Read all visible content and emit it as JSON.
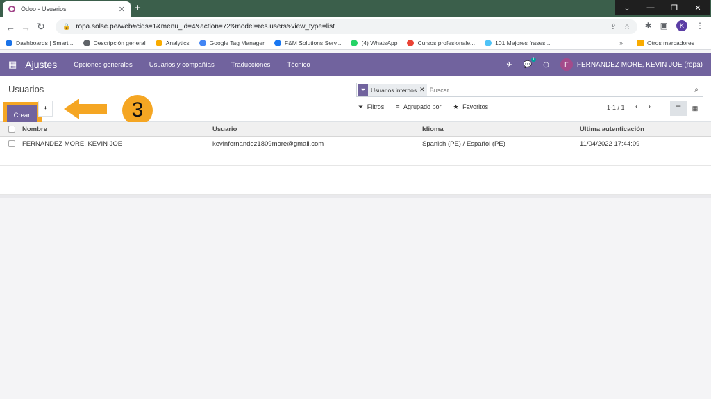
{
  "browser": {
    "tab_title": "Odoo - Usuarios",
    "tab_close": "✕",
    "new_tab": "+",
    "url": "ropa.solse.pe/web#cids=1&menu_id=4&action=72&model=res.users&view_type=list",
    "profile_initial": "K",
    "bookmarks": [
      {
        "label": "Dashboards | Smart...",
        "color": "#1a73e8"
      },
      {
        "label": "Descripción general",
        "color": "#5f6368"
      },
      {
        "label": "Analytics",
        "color": "#f9ab00"
      },
      {
        "label": "Google Tag Manager",
        "color": "#4285f4"
      },
      {
        "label": "F&M Solutions Serv...",
        "color": "#1877f2"
      },
      {
        "label": "(4) WhatsApp",
        "color": "#25d366"
      },
      {
        "label": "Cursos profesionale...",
        "color": "#ea4335"
      },
      {
        "label": "101 Mejores frases...",
        "color": "#4fc3f7"
      }
    ],
    "bookmarks_more": "»",
    "other_bookmarks": "Otros marcadores"
  },
  "odoo_nav": {
    "app_title": "Ajustes",
    "menu": [
      "Opciones generales",
      "Usuarios y compañías",
      "Traducciones",
      "Técnico"
    ],
    "message_count": "1",
    "user_initial": "F",
    "user_name": "FERNANDEZ MORE, KEVIN JOE (ropa)"
  },
  "control_panel": {
    "breadcrumb": "Usuarios",
    "create_label": "Crear",
    "facet_label": "Usuarios internos",
    "search_placeholder": "Buscar...",
    "filters_label": "Filtros",
    "groupby_label": "Agrupado por",
    "favorites_label": "Favoritos",
    "pager": "1-1 / 1"
  },
  "annotation": {
    "step_number": "3",
    "accent": "#f5a623"
  },
  "table": {
    "columns": [
      "Nombre",
      "Usuario",
      "Idioma",
      "Última autenticación"
    ],
    "rows": [
      [
        "FERNANDEZ MORE, KEVIN JOE",
        "kevinfernandez1809more@gmail.com",
        "Spanish (PE) / Español (PE)",
        "11/04/2022 17:44:09"
      ]
    ]
  },
  "colors": {
    "brand": "#71639e",
    "chrome_frame": "#3b5f4b"
  }
}
